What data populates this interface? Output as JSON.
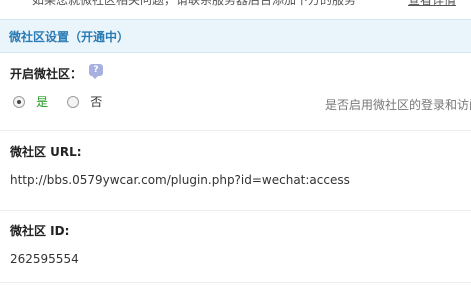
{
  "top_strip": {
    "cut_text": "如果您就微社区相关问题，请联系服务器后台添加下方的服务",
    "cut_link": "查看详情"
  },
  "section": {
    "title": "微社区设置（开通中）"
  },
  "enable_row": {
    "label": "开启微社区：",
    "help_icon": "?",
    "options": [
      {
        "label": "是",
        "checked": true
      },
      {
        "label": "否",
        "checked": false
      }
    ],
    "description": "是否启用微社区的登录和访问"
  },
  "url_row": {
    "label": "微社区 URL:",
    "value": "http://bbs.0579ywcar.com/plugin.php?id=wechat:access"
  },
  "id_row": {
    "label": "微社区 ID:",
    "value": "262595554"
  }
}
